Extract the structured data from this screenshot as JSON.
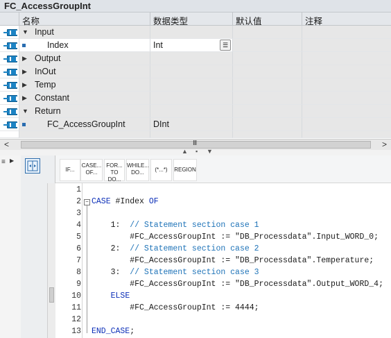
{
  "title": "FC_AccessGroupInt",
  "interface": {
    "columns": [
      "名称",
      "数据类型",
      "默认值",
      "注释"
    ],
    "rows": [
      {
        "kind": "section",
        "expanded": true,
        "name": "Input",
        "type": ""
      },
      {
        "kind": "param",
        "name": "Index",
        "type": "Int"
      },
      {
        "kind": "section",
        "expanded": false,
        "name": "Output",
        "type": ""
      },
      {
        "kind": "section",
        "expanded": false,
        "name": "InOut",
        "type": ""
      },
      {
        "kind": "section",
        "expanded": false,
        "name": "Temp",
        "type": ""
      },
      {
        "kind": "section",
        "expanded": false,
        "name": "Constant",
        "type": ""
      },
      {
        "kind": "section",
        "expanded": true,
        "name": "Return",
        "type": ""
      },
      {
        "kind": "param",
        "name": "FC_AccessGroupInt",
        "type": "DInt"
      }
    ]
  },
  "scrollbar": {
    "left": "<",
    "right": ">",
    "grip": "III"
  },
  "keywords": [
    {
      "label": "IF...",
      "lines": [
        "IF..."
      ]
    },
    {
      "label": "CASE... OF...",
      "lines": [
        "CASE...",
        "OF..."
      ]
    },
    {
      "label": "FOR... TO DO...",
      "lines": [
        "FOR...",
        "TO DO..."
      ]
    },
    {
      "label": "WHILE... DO...",
      "lines": [
        "WHILE...",
        "DO..."
      ]
    },
    {
      "label": "(*...*)",
      "lines": [
        "(*...*)"
      ]
    },
    {
      "label": "REGION",
      "lines": [
        "REGION"
      ]
    }
  ],
  "code_lines": [
    {
      "n": "1",
      "text": ""
    },
    {
      "n": "2",
      "text": "CASE #Index OF"
    },
    {
      "n": "3",
      "text": ""
    },
    {
      "n": "4",
      "text": "    1:  // Statement section case 1"
    },
    {
      "n": "5",
      "text": "        #FC_AccessGroupInt := \"DB_Processdata\".Input_WORD_0;"
    },
    {
      "n": "6",
      "text": "    2:  // Statement section case 2"
    },
    {
      "n": "7",
      "text": "        #FC_AccessGroupInt := \"DB_Processdata\".Temperature;"
    },
    {
      "n": "8",
      "text": "    3:  // Statement section case 3"
    },
    {
      "n": "9",
      "text": "        #FC_AccessGroupInt := \"DB_Processdata\".Output_WORD_4;"
    },
    {
      "n": "10",
      "text": "    ELSE"
    },
    {
      "n": "11",
      "text": "        #FC_AccessGroupInt := 4444;"
    },
    {
      "n": "12",
      "text": ""
    },
    {
      "n": "13",
      "text": "END_CASE;"
    }
  ],
  "colors": {
    "keyword": "#0c2fb8",
    "comment": "#1e73b8",
    "port_icon": "#1c83c4"
  }
}
